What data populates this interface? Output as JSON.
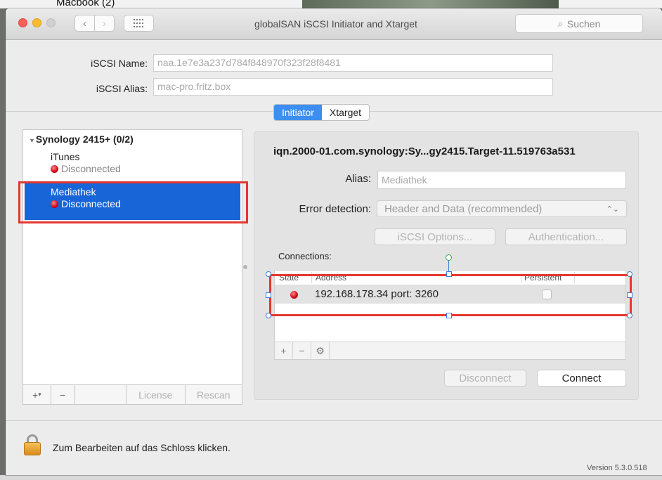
{
  "backdrop": {
    "text": "Macbook (2)"
  },
  "window": {
    "title": "globalSAN iSCSI Initiator and Xtarget",
    "search_placeholder": "Suchen"
  },
  "identity": {
    "name_label": "iSCSI Name:",
    "name_value": "naa.1e7e3a237d784f848970f323f28f8481",
    "alias_label": "iSCSI Alias:",
    "alias_value": "mac-pro.fritz.box"
  },
  "tabs": [
    {
      "label": "Initiator",
      "active": true
    },
    {
      "label": "Xtarget",
      "active": false
    }
  ],
  "tree": {
    "group": "Synology 2415+ (0/2)",
    "items": [
      {
        "name": "iTunes",
        "status": "Disconnected",
        "selected": false
      },
      {
        "name": "Mediathek",
        "status": "Disconnected",
        "selected": true
      }
    ],
    "bottom": {
      "add": "+",
      "add_menu": "▾",
      "remove": "−",
      "license": "License",
      "rescan": "Rescan"
    }
  },
  "detail": {
    "target_name": "iqn.2000-01.com.synology:Sy...gy2415.Target-11.519763a531",
    "alias_label": "Alias:",
    "alias_placeholder": "Mediathek",
    "error_label": "Error detection:",
    "error_value": "Header and Data (recommended)",
    "iscsi_options": "iSCSI Options...",
    "authentication": "Authentication...",
    "connections_label": "Connections:",
    "columns": {
      "state": "State",
      "address": "Address",
      "persistent": "Persistent"
    },
    "connections": [
      {
        "address": "192.168.178.34 port: 3260",
        "persistent": false
      }
    ],
    "bar": {
      "add": "+",
      "remove": "−",
      "gear": "⚙"
    },
    "disconnect": "Disconnect",
    "connect": "Connect"
  },
  "footer": {
    "lock_text": "Zum Bearbeiten auf das Schloss klicken.",
    "version": "Version 5.3.0.518"
  },
  "colors": {
    "selection": "#1765d7",
    "tab_active": "#3c8ef0",
    "highlight": "#e53731",
    "status_red": "#d0001a"
  }
}
